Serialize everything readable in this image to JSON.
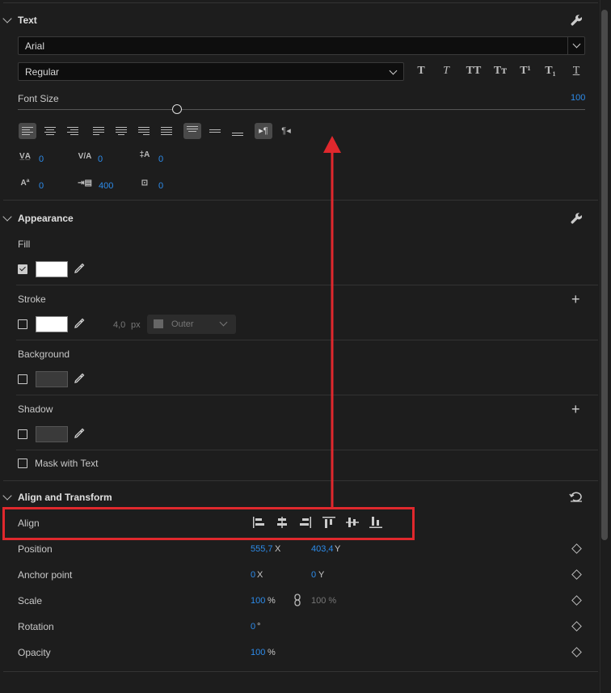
{
  "text_section": {
    "title": "Text",
    "font_family": "Arial",
    "font_style": "Regular",
    "typo_buttons": [
      "T",
      "T",
      "TT",
      "Tт",
      "T¹",
      "T₁",
      "T"
    ],
    "font_size_label": "Font Size",
    "font_size_value": "100",
    "slider_level": 0.28,
    "metrics": {
      "kerning": "0",
      "tracking": "0",
      "leading": "0",
      "baseline": "0",
      "tsume": "400",
      "tab_width": "0"
    }
  },
  "appearance": {
    "title": "Appearance",
    "fill_label": "Fill",
    "stroke_label": "Stroke",
    "stroke_width": "4,0",
    "stroke_unit": "px",
    "stroke_type": "Outer",
    "background_label": "Background",
    "shadow_label": "Shadow",
    "mask_label": "Mask with Text"
  },
  "align_transform": {
    "title": "Align and Transform",
    "align_label": "Align",
    "position_label": "Position",
    "position_x": "555,7",
    "position_y": "403,4",
    "anchor_label": "Anchor point",
    "anchor_x": "0",
    "anchor_y": "0",
    "scale_label": "Scale",
    "scale_value": "100",
    "scale_unit": "%",
    "scale_linked": "100 %",
    "rotation_label": "Rotation",
    "rotation_value": "0",
    "rotation_unit": "°",
    "opacity_label": "Opacity",
    "opacity_value": "100",
    "opacity_unit": "%",
    "x_suffix": "X",
    "y_suffix": "Y"
  },
  "colors": {
    "accent": "#2d8ceb",
    "annotation": "#e0282d",
    "panel_bg": "#1d1d1d"
  }
}
